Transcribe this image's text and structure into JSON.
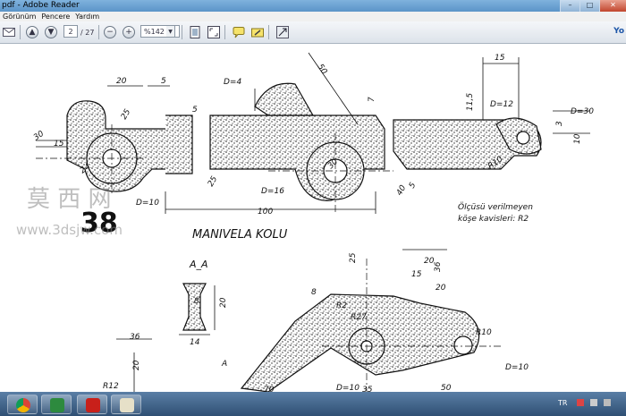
{
  "window": {
    "title": "pdf - Adobe Reader",
    "controls": [
      "–",
      "□",
      "✕"
    ]
  },
  "menu": [
    "Görünüm",
    "Pencere",
    "Yardım"
  ],
  "toolbar": {
    "current_page": "2",
    "page_total": "/ 27",
    "zoom": "%142",
    "right_label": "Yo"
  },
  "drawing": {
    "dims_top": [
      "20",
      "5",
      "5",
      "D=4",
      "50",
      "7",
      "15",
      "11,5",
      "D=12",
      "D=30",
      "3",
      "10",
      "30",
      "15",
      "24",
      "25",
      "30",
      "D=10",
      "D=16",
      "100",
      "25",
      "R10",
      "40",
      "5"
    ],
    "section_dims": [
      "8",
      "20",
      "14"
    ],
    "dims_bottom": [
      "36",
      "20",
      "R12",
      "A",
      "70",
      "R27",
      "8",
      "25",
      "R2",
      "20",
      "36",
      "15",
      "20",
      "R10",
      "D=10",
      "D=10",
      "35",
      "50"
    ],
    "title": "MANIVELA KOLU",
    "note_line1": "Ölçüsü verilmeyen",
    "note_line2": "köşe kavisleri: R2",
    "section_label": "A_A",
    "number": "38",
    "watermark_cn": "莫 西 网",
    "watermark_url": "www.3dsjw.com"
  },
  "taskbar": {
    "lang": "TR"
  },
  "colors": {
    "titlebar": "#6fa3d4",
    "taskbar": "#3a5f87"
  }
}
